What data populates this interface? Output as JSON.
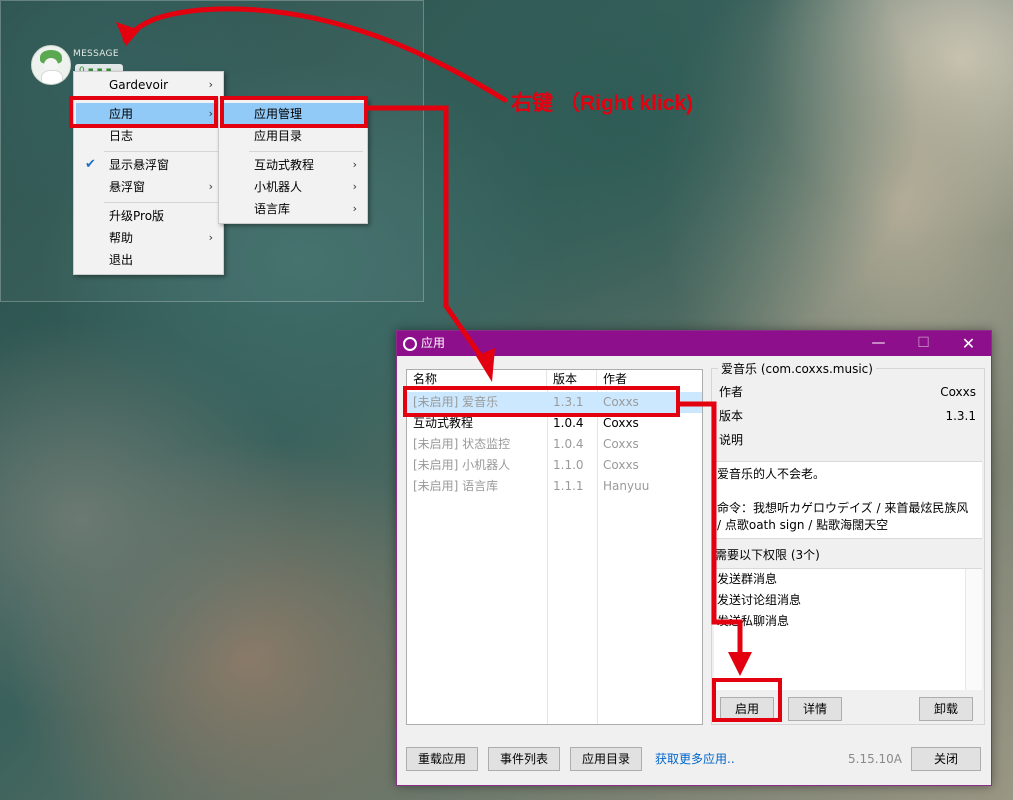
{
  "annotation": {
    "text": "右键 （Right klick)",
    "color": "#e3000f"
  },
  "float_widget": {
    "label": "MESSAGE",
    "status": "0 ▪ ▪ ▪"
  },
  "context_menu": {
    "items": [
      {
        "label": "Gardevoir",
        "has_submenu": true
      },
      {
        "label": "应用",
        "has_submenu": true,
        "highlighted": true
      },
      {
        "label": "日志"
      },
      {
        "label": "显示悬浮窗",
        "checked": true
      },
      {
        "label": "悬浮窗",
        "has_submenu": true
      },
      {
        "label": "升级Pro版"
      },
      {
        "label": "帮助",
        "has_submenu": true
      },
      {
        "label": "退出"
      }
    ],
    "submenu": [
      {
        "label": "应用管理",
        "highlighted": true
      },
      {
        "label": "应用目录"
      },
      {
        "label": "互动式教程",
        "has_submenu": true
      },
      {
        "label": "小机器人",
        "has_submenu": true
      },
      {
        "label": "语言库",
        "has_submenu": true
      }
    ],
    "arrow_glyph": "›",
    "check_glyph": "✔"
  },
  "window": {
    "title": "应用",
    "title_color": "#8e0f8b",
    "controls": {
      "minimize": "—",
      "maximize": "☐",
      "close": "✕"
    },
    "list": {
      "headers": [
        "名称",
        "版本",
        "作者"
      ],
      "rows": [
        {
          "name": "[未启用] 爱音乐",
          "version": "1.3.1",
          "author": "Coxxs",
          "disabled": true,
          "selected": true
        },
        {
          "name": "互动式教程",
          "version": "1.0.4",
          "author": "Coxxs",
          "disabled": false
        },
        {
          "name": "[未启用] 状态监控",
          "version": "1.0.4",
          "author": "Coxxs",
          "disabled": true
        },
        {
          "name": "[未启用] 小机器人",
          "version": "1.1.0",
          "author": "Coxxs",
          "disabled": true
        },
        {
          "name": "[未启用] 语言库",
          "version": "1.1.1",
          "author": "Hanyuu",
          "disabled": true
        }
      ]
    },
    "detail": {
      "group_title": "爱音乐 (com.coxxs.music)",
      "author_label": "作者",
      "author_value": "Coxxs",
      "version_label": "版本",
      "version_value": "1.3.1",
      "desc_label": "说明",
      "description_line1": "爱音乐的人不会老。",
      "description_line2": "命令：我想听カゲロウデイズ / 来首最炫民族风",
      "description_line3": "/ 点歌oath sign / 點歌海闊天空",
      "permissions_title": "需要以下权限 (3个)",
      "permissions": [
        "发送群消息",
        "发送讨论组消息",
        "发送私聊消息"
      ],
      "enable_button": "启用",
      "details_button": "详情",
      "uninstall_button": "卸载"
    },
    "footer": {
      "reload_button": "重载应用",
      "events_button": "事件列表",
      "catalog_button": "应用目录",
      "more_link": "获取更多应用..",
      "version": "5.15.10A",
      "close_button": "关闭"
    }
  }
}
